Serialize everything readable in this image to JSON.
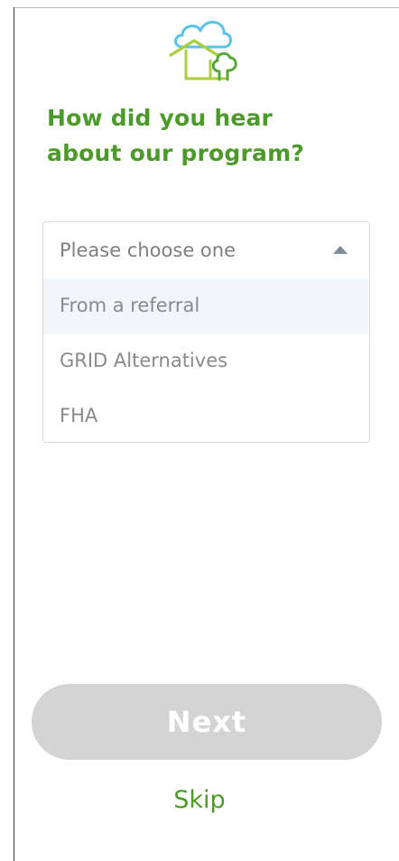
{
  "colors": {
    "brand_green": "#4b9a2a",
    "logo_blue": "#5bc3e8",
    "logo_lime": "#a9cf3d",
    "logo_green": "#57a83a",
    "dropdown_text": "#7f7f7f",
    "option_text": "#8a8a8a",
    "caret": "#7d8c9c",
    "highlight_bg": "#f2f6f9",
    "button_bg": "#d4d4d4",
    "button_text": "#ffffff",
    "skip_text": "#4b9a2a"
  },
  "logo": {
    "icon": "cloud-house-tree-logo"
  },
  "question": {
    "line1": "How did you hear",
    "line2": "about our program?"
  },
  "dropdown": {
    "placeholder": "Please choose one",
    "expanded": true,
    "caret_icon": "caret-up-icon",
    "options": [
      {
        "label": "From a referral",
        "highlighted": true
      },
      {
        "label": "GRID Alternatives",
        "highlighted": false
      },
      {
        "label": "FHA",
        "highlighted": false
      }
    ]
  },
  "actions": {
    "next_label": "Next",
    "next_disabled": true,
    "skip_label": "Skip"
  }
}
